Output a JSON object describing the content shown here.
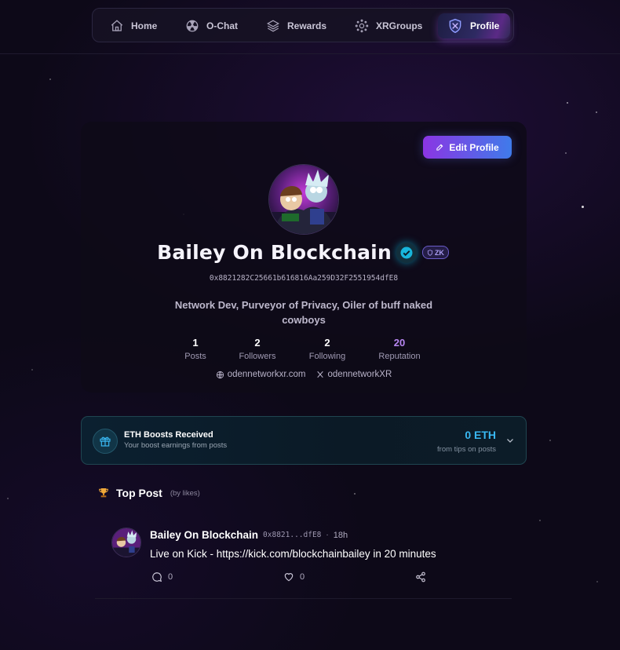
{
  "nav": {
    "items": [
      {
        "label": "Home",
        "icon": "home-icon"
      },
      {
        "label": "O-Chat",
        "icon": "radiation-icon"
      },
      {
        "label": "Rewards",
        "icon": "layers-icon"
      },
      {
        "label": "XRGroups",
        "icon": "network-icon"
      },
      {
        "label": "Profile",
        "icon": "shield-icon",
        "active": true
      }
    ]
  },
  "profile": {
    "edit_label": "Edit Profile",
    "name": "Bailey On Blockchain",
    "zk_badge": "ZK",
    "address": "0x8821282C25661b616816Aa259D32F2551954dfE8",
    "bio": "Network Dev, Purveyor of Privacy, Oiler of buff naked cowboys",
    "stats": [
      {
        "value": "1",
        "label": "Posts"
      },
      {
        "value": "2",
        "label": "Followers"
      },
      {
        "value": "2",
        "label": "Following"
      },
      {
        "value": "20",
        "label": "Reputation"
      }
    ],
    "links": {
      "website": "odennetworkxr.com",
      "x": "odennetworkXR"
    }
  },
  "boosts": {
    "title": "ETH Boosts Received",
    "subtitle": "Your boost earnings from posts",
    "amount": "0 ETH",
    "note": "from tips on posts"
  },
  "top_post": {
    "title": "Top Post",
    "subtitle": "(by likes)",
    "post": {
      "author": "Bailey On Blockchain",
      "address": "0x8821...dfE8",
      "separator": "·",
      "time": "18h",
      "text": "Live on Kick - https://kick.com/blockchainbailey in 20 minutes",
      "comments": "0",
      "likes": "0"
    }
  },
  "colors": {
    "background": "#0d0918",
    "accent_purple": "#8b35e3",
    "accent_blue": "#3f7bea",
    "eth_blue": "#39b7f1",
    "reputation": "#b786f0",
    "verified": "#00c8f0"
  }
}
